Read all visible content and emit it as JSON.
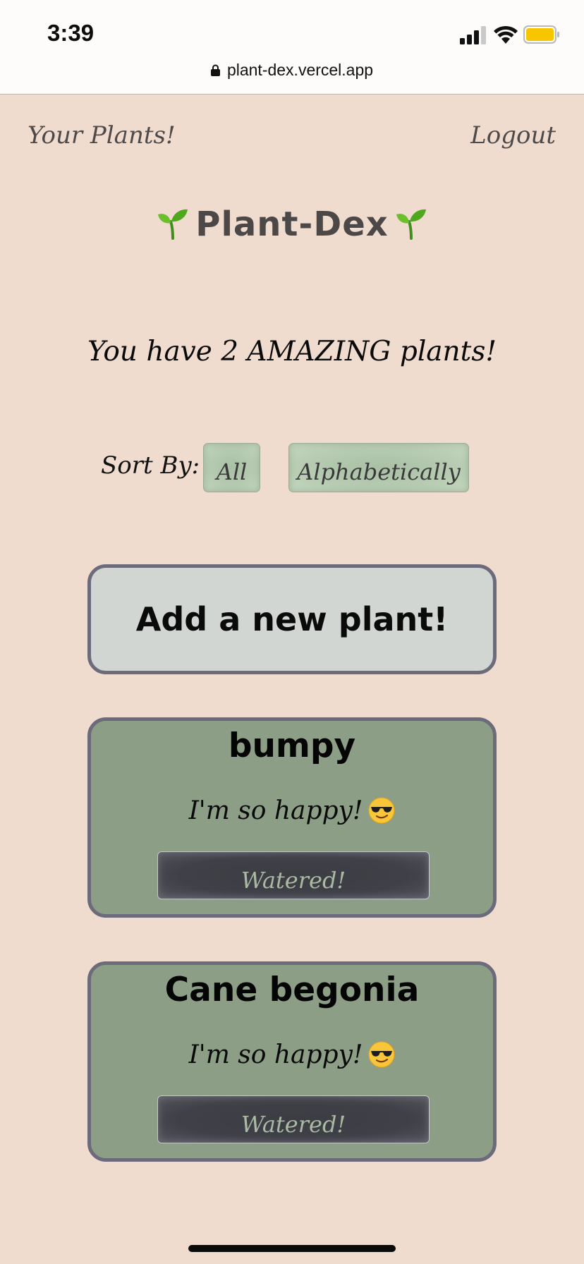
{
  "status_bar": {
    "time": "3:39",
    "url": "plant-dex.vercel.app",
    "icons": [
      "signal-icon",
      "wifi-icon",
      "battery-icon",
      "lock-icon"
    ]
  },
  "nav": {
    "your_plants": "Your Plants!",
    "logout": "Logout"
  },
  "header": {
    "title": "Plant-Dex",
    "title_icon": "sprout-icon"
  },
  "summary": {
    "text": "You have 2 AMAZING plants!"
  },
  "sort": {
    "label": "Sort By:",
    "options": [
      "All",
      "Alphabetically"
    ]
  },
  "add_plant": {
    "label": "Add a new plant!"
  },
  "plants": [
    {
      "name": "bumpy",
      "mood": "I'm so happy!",
      "mood_icon": "sunglasses-emoji-icon",
      "action": "Watered!"
    },
    {
      "name": "Cane begonia",
      "mood": "I'm so happy!",
      "mood_icon": "sunglasses-emoji-icon",
      "action": "Watered!"
    }
  ],
  "colors": {
    "background": "#f0dccf",
    "card_green": "#8d9e87",
    "card_border": "#6b6b7b",
    "add_card": "#d2d6d3",
    "water_button": "#404048",
    "battery": "#f7c600"
  }
}
